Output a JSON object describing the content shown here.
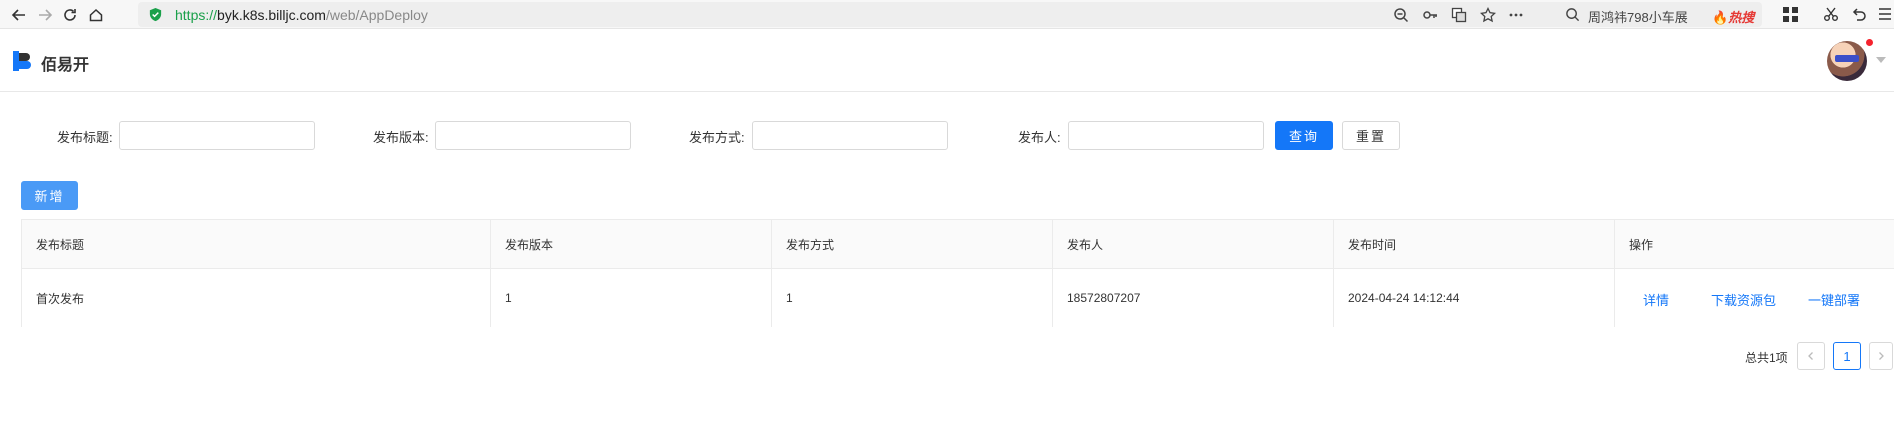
{
  "browser": {
    "url_scheme": "https://",
    "url_host": "byk.k8s.billjc.com",
    "url_path": "/web/AppDeploy",
    "search_text": "周鸿祎798小车展",
    "search_hot": "热搜"
  },
  "app": {
    "brand": "佰易开"
  },
  "filters": {
    "title_label": "发布标题:",
    "title_value": "",
    "version_label": "发布版本:",
    "version_value": "",
    "method_label": "发布方式:",
    "method_value": "",
    "publisher_label": "发布人:",
    "publisher_value": "",
    "query_button": "查询",
    "reset_button": "重置"
  },
  "actions": {
    "add_button": "新增"
  },
  "table": {
    "columns": [
      "发布标题",
      "发布版本",
      "发布方式",
      "发布人",
      "发布时间",
      "操作"
    ],
    "rows": [
      {
        "title": "首次发布",
        "version": "1",
        "method": "1",
        "publisher": "18572807207",
        "time": "2024-04-24 14:12:44",
        "ops": [
          "详情",
          "下载资源包",
          "一键部署"
        ]
      }
    ]
  },
  "pagination": {
    "total_text": "总共1项",
    "current_page": "1"
  }
}
